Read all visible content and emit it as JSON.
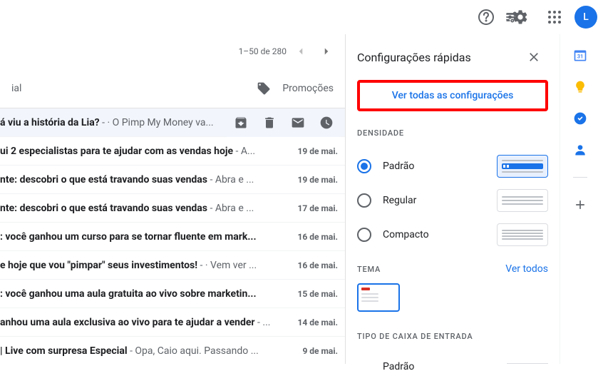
{
  "topbar": {
    "avatar_initial": "L"
  },
  "toolbar": {
    "page_count": "1–50 de 280"
  },
  "tabs": {
    "partial": "ial",
    "promo": "Promoções"
  },
  "emails": [
    {
      "subject": "á viu a história da Lia?",
      "snippet": " - · O Pimp My Money va...",
      "date": ""
    },
    {
      "subject": "ui 2 especialistas para te ajudar com as vendas hoje",
      "snippet": " - A...",
      "date": "19 de mai."
    },
    {
      "subject": "nte: descobri o que está travando suas vendas",
      "snippet": " - Abra e ...",
      "date": "19 de mai."
    },
    {
      "subject": "nte: descobri o que está travando suas vendas",
      "snippet": " - Abra e ...",
      "date": "17 de mai."
    },
    {
      "subject": ": você ganhou um curso para se tornar fluente em mark...",
      "snippet": "",
      "date": "16 de mai."
    },
    {
      "subject": "e hoje que vou \"pimpar\" seus investimentos!",
      "snippet": " - · Vem ver ...",
      "date": "16 de mai."
    },
    {
      "subject": ": você ganhou uma aula gratuita ao vivo sobre marketin...",
      "snippet": "",
      "date": "15 de mai."
    },
    {
      "subject": "anhou uma aula exclusiva ao vivo para te ajudar a vender",
      "snippet": " - ...",
      "date": "14 de mai."
    },
    {
      "subject": "| Live com surpresa Especial",
      "snippet": " - Opa, Caio aqui. Passando ...",
      "date": "9 de mai."
    }
  ],
  "settings": {
    "title": "Configurações rápidas",
    "see_all": "Ver todas as configurações",
    "density_label": "DENSIDADE",
    "density": [
      {
        "label": "Padrão",
        "checked": true
      },
      {
        "label": "Regular",
        "checked": false
      },
      {
        "label": "Compacto",
        "checked": false
      }
    ],
    "theme_label": "TEMA",
    "see_all_themes": "Ver todos",
    "inbox_type_label": "TIPO DE CAIXA DE ENTRADA",
    "inbox_default": "Padrão"
  },
  "sidepanel": {
    "calendar_day": "31"
  }
}
